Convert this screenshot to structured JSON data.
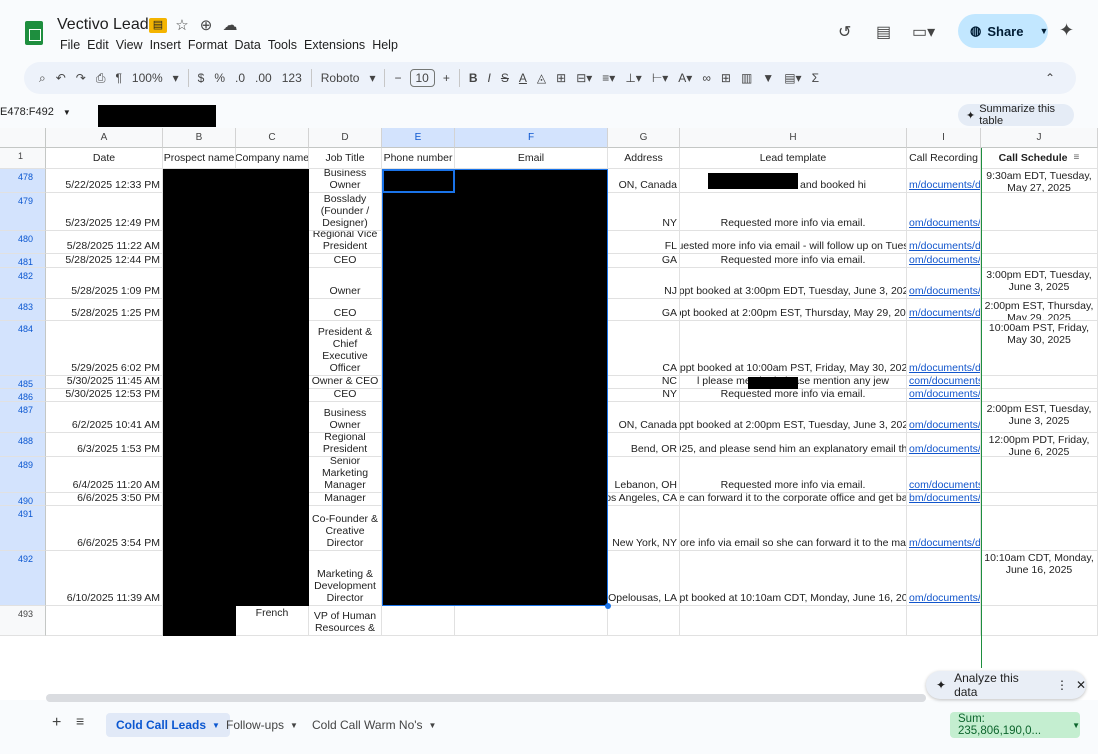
{
  "title": {
    "doc_name": "Vectivo Leads",
    "menus": [
      "File",
      "Edit",
      "View",
      "Insert",
      "Format",
      "Data",
      "Tools",
      "Extensions",
      "Help"
    ],
    "share_label": "Share"
  },
  "toolbar": {
    "zoom": "100%",
    "currency": "$",
    "percent": "%",
    "dec_decrease": ".0",
    "dec_increase": ".00",
    "number_format": "123",
    "font": "Roboto",
    "font_size": "10",
    "bold": "B",
    "italic": "I",
    "strike": "S",
    "text_color": "A",
    "sum": "Σ"
  },
  "formula_bar": {
    "name_box": "E478:F492",
    "summarize_label": "Summarize this table"
  },
  "columns": [
    "A",
    "B",
    "C",
    "D",
    "E",
    "F",
    "G",
    "H",
    "I",
    "J"
  ],
  "header_row": {
    "row_number": "1",
    "cells": [
      "Date",
      "Prospect name",
      "Company name",
      "Job Title",
      "Phone number",
      "Email",
      "Address",
      "Lead template",
      "Call Recording",
      "Call Schedule"
    ]
  },
  "rows": [
    {
      "n": "478",
      "date": "5/22/2025 12:33 PM",
      "company": "",
      "title": "Small Business Owner",
      "address": "ON, Canada",
      "lead": "which                                 called him and booked hi",
      "rec": "m/documents/d",
      "sched": "9:30am EDT, Tuesday, May 27, 2025"
    },
    {
      "n": "479",
      "date": "5/23/2025 12:49 PM",
      "company": "",
      "title": "Bosslady (Founder / Designer)",
      "address": "NY",
      "lead": "Requested more info via email.",
      "rec": "om/documents/",
      "sched": ""
    },
    {
      "n": "480",
      "date": "5/28/2025 11:22 AM",
      "company": "",
      "title": "Regional Vice President",
      "address": "FL",
      "lead": "quested more info via email - will follow up on Tuesd",
      "rec": "m/documents/dc",
      "sched": ""
    },
    {
      "n": "481",
      "date": "5/28/2025 12:44 PM",
      "company": "",
      "title": "CEO",
      "address": "GA",
      "lead": "Requested more info via email.",
      "rec": "om/documents/",
      "sched": ""
    },
    {
      "n": "482",
      "date": "5/28/2025 1:09 PM",
      "company": "",
      "title": "Owner",
      "address": "NJ",
      "lead": "Appt booked at 3:00pm EDT, Tuesday, June 3, 2025",
      "rec": "om/documents/",
      "sched": "3:00pm EDT, Tuesday, June 3, 2025"
    },
    {
      "n": "483",
      "date": "5/28/2025 1:25 PM",
      "company": "",
      "title": "CEO",
      "address": "GA",
      "lead": "Appt booked at 2:00pm EST, Thursday, May 29, 2025",
      "rec": "m/documents/dc",
      "sched": "2:00pm EST, Thursday, May 29, 2025"
    },
    {
      "n": "484",
      "date": "5/29/2025 6:02 PM",
      "company": "",
      "title": "President & Chief Executive Officer",
      "address": "CA",
      "lead": "Appt booked at 10:00am PST, Friday, May 30, 2025",
      "rec": "m/documents/d",
      "sched": "10:00am PST, Friday, May 30, 2025"
    },
    {
      "n": "485",
      "date": "5/30/2025 11:45 AM",
      "company": "",
      "title": "Owner & CEO",
      "address": "NC",
      "lead": "l please mentio                     d please mention any jew",
      "rec": "com/documents/",
      "sched": ""
    },
    {
      "n": "486",
      "date": "5/30/2025 12:53 PM",
      "company": "",
      "title": "Founder + CEO",
      "address": "NY",
      "lead": "Requested more info via email.",
      "rec": "om/documents/",
      "sched": ""
    },
    {
      "n": "487",
      "date": "6/2/2025 10:41 AM",
      "company": "",
      "title": "Business Owner",
      "address": "ON, Canada",
      "lead": "Appt booked at 2:00pm EST, Tuesday, June 3, 2025",
      "rec": "om/documents/",
      "sched": "2:00pm EST, Tuesday, June 3, 2025"
    },
    {
      "n": "488",
      "date": "6/3/2025 1:53 PM",
      "company": "",
      "title": "Regional President",
      "address": "Bend, OR",
      "lead": "2025, and please send him an explanatory email that",
      "rec": "om/documents/d",
      "sched": "12:00pm PDT, Friday, June 6, 2025"
    },
    {
      "n": "489",
      "date": "6/4/2025 11:20 AM",
      "company": "",
      "title": "Senior Marketing Manager",
      "address": "Lebanon, OH",
      "lead": "Requested more info via email.",
      "rec": "com/documents/",
      "sched": ""
    },
    {
      "n": "490",
      "date": "6/6/2025 3:50 PM",
      "company": "",
      "title": "Studio Manager",
      "address": "Los Angeles, CA",
      "lead": "he can forward it to the corporate office and get bac",
      "rec": "bm/documents/d",
      "sched": ""
    },
    {
      "n": "491",
      "date": "6/6/2025 3:54 PM",
      "company": "",
      "title": "Co-Founder & Creative Director",
      "address": "New York, NY",
      "lead": "more info via email so she can forward it to the mark",
      "rec": "m/documents/d",
      "sched": ""
    },
    {
      "n": "492",
      "date": "6/10/2025 11:39 AM",
      "company": "",
      "title": "Marketing & Development Director",
      "address": "Opelousas, LA",
      "lead": "Appt booked at 10:10am CDT, Monday, June 16, 2025",
      "rec": "om/documents/",
      "sched": "10:10am CDT, Monday, June 16, 2025"
    },
    {
      "n": "493",
      "date": "",
      "company": "French",
      "title": "VP of Human Resources &",
      "address": "",
      "lead": "",
      "rec": "",
      "sched": ""
    }
  ],
  "analyze_chip": {
    "label": "Analyze this data"
  },
  "sheet_tabs": [
    {
      "label": "Cold Call Leads",
      "active": true
    },
    {
      "label": "Follow-ups",
      "active": false
    },
    {
      "label": "Cold Call Warm No's",
      "active": false
    }
  ],
  "sum_chip": "Sum: 235,806,190,0...",
  "colors": {
    "accent": "#0b57d0",
    "share_bg": "#c2e7ff",
    "selection": "#1a73e8",
    "sheets_green": "#1e8e3e"
  }
}
